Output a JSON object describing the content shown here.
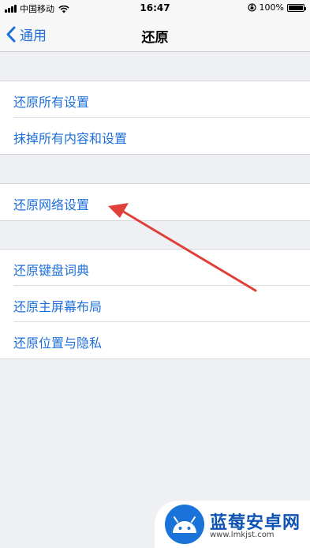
{
  "status_bar": {
    "carrier": "中国移动",
    "time": "16:47",
    "battery": "100%"
  },
  "nav": {
    "back_label": "通用",
    "title": "还原"
  },
  "groups": [
    [
      "还原所有设置",
      "抹掉所有内容和设置"
    ],
    [
      "还原网络设置"
    ],
    [
      "还原键盘词典",
      "还原主屏幕布局",
      "还原位置与隐私"
    ]
  ],
  "watermark": {
    "title": "蓝莓安卓网",
    "url": "www.lmkjst.com"
  },
  "colors": {
    "accent": "#1e6fd9",
    "annotation_arrow": "#e0403a",
    "background": "#eff0f4"
  }
}
